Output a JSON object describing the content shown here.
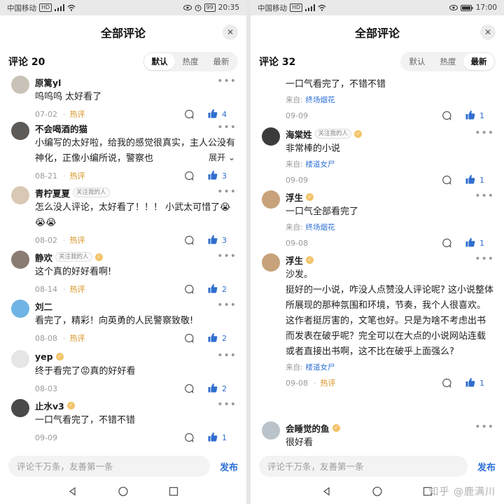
{
  "left": {
    "status": {
      "carrier": "中国移动",
      "net": "HD",
      "battery": "99",
      "time": "20:35"
    },
    "title": "全部评论",
    "close": "✕",
    "count": "评论 20",
    "sort_tabs": [
      "默认",
      "热度",
      "最新"
    ],
    "comments": [
      {
        "name": "原篱yl",
        "text": "呜呜呜 太好看了",
        "date": "07-02",
        "hot": "热评",
        "likes": "4",
        "avatar_color": "#c9c2b8"
      },
      {
        "name": "不会喝酒的猫",
        "text": "小编写的太好啦，给我的感觉很真实，主人公没有神化，正像小编所说，警察也",
        "expand": "展开",
        "date": "08-21",
        "hot": "热评",
        "likes": "3",
        "avatar_color": "#5d5a57"
      },
      {
        "name": "青柠夏夏",
        "follow": "关注我的人",
        "text": "怎么没人评论，太好看了！！！ 小武太可惜了😭😭😭",
        "date": "08-02",
        "hot": "热评",
        "likes": "3",
        "avatar_color": "#d9c8b3"
      },
      {
        "name": "静欢",
        "follow": "关注我的人",
        "badge": "✓",
        "text": "这个真的好好看啊!",
        "date": "08-14",
        "hot": "热评",
        "likes": "2",
        "avatar_color": "#8a7b73"
      },
      {
        "name": "刘二",
        "text": "看完了，精彩！向英勇的人民警察致敬!",
        "date": "08-08",
        "hot": "热评",
        "likes": "2",
        "avatar_color": "#6fb4e4"
      },
      {
        "name": "yep",
        "badge": "✓",
        "text": "终于看完了😡真的好好看",
        "date": "08-03",
        "likes": "2",
        "avatar_color": "#e6e6e6"
      },
      {
        "name": "止水v3",
        "badge": "✓",
        "text": "一口气看完了，不错不错",
        "date": "09-09",
        "likes": "1",
        "avatar_color": "#4a4a4a"
      }
    ],
    "input_placeholder": "评论千万条，友善第一条",
    "publish": "发布"
  },
  "right": {
    "status": {
      "carrier": "中国移动",
      "net": "HD",
      "time": "17:00"
    },
    "title": "全部评论",
    "close": "✕",
    "count": "评论 32",
    "sort_tabs": [
      "默认",
      "热度",
      "最新"
    ],
    "comments": [
      {
        "text": "一口气看完了，不错不错",
        "source_label": "来自:",
        "source": "终场烟花",
        "date": "09-09",
        "likes": "1"
      },
      {
        "name": "海棠姓",
        "follow": "关注我的人",
        "badge": "✓",
        "text": "非常棒的小说",
        "source_label": "来自:",
        "source": "楼道女尸",
        "date": "09-09",
        "likes": "1",
        "avatar_color": "#3b3b3b"
      },
      {
        "name": "浮生",
        "badge": "✓",
        "text": "一口气全部看完了",
        "source_label": "来自:",
        "source": "终场烟花",
        "date": "09-08",
        "likes": "1",
        "avatar_color": "#c7a27a"
      },
      {
        "name": "浮生",
        "badge": "✓",
        "text": "沙发。\n挺好的一小说，咋没人点赞没人评论呢? 这小说整体所展现的那种氛围和环境，节奏，我个人很喜欢。\n这作者挺厉害的，文笔也好。只是为啥不考虑出书而发表在破乎呢？完全可以在大点的小说网站连载或者直接出书啊，这不比在破乎上面强么?",
        "source_label": "来自:",
        "source": "楼道女尸",
        "date": "09-08",
        "hot": "热评",
        "likes": "1",
        "avatar_color": "#c7a27a"
      },
      {
        "name": "会睡觉的鱼",
        "badge": "✓",
        "text": "很好看",
        "avatar_color": "#b9c3c9"
      }
    ],
    "input_placeholder": "评论千万条，友善第一条",
    "publish": "发布"
  },
  "watermark": "知乎 @鹿满川",
  "colors": {
    "accent": "#2b6fd6",
    "hot": "#d8921e",
    "like": "#2f6ecf"
  },
  "icons": [
    "signal-icon",
    "wifi-icon",
    "eye-icon",
    "alarm-icon",
    "comment-icon",
    "thumbs-up-icon",
    "more-icon",
    "close-icon",
    "back-nav-icon",
    "home-nav-icon",
    "recents-nav-icon",
    "chevron-down-icon"
  ]
}
